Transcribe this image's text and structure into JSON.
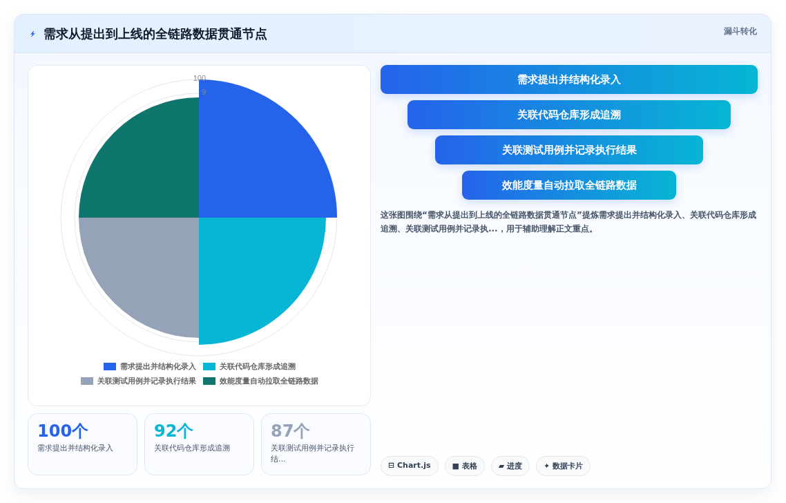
{
  "header": {
    "title": "需求从提出到上线的全链路数据贯通节点",
    "tag": "漏斗转化"
  },
  "chart": {
    "ticks": [
      "100",
      "9"
    ],
    "slices": [
      {
        "label": "需求提出并结构化录入",
        "color": "#2563eb",
        "level": 1
      },
      {
        "label": "关联代码仓库形成追溯",
        "color": "#06b6d4",
        "level": 0.92
      },
      {
        "label": "关联测试用例并记录执行结果",
        "color": "#94a3b8",
        "level": 0.87
      },
      {
        "label": "效能度量自动拉取全链路数据",
        "color": "#0f766e",
        "level": 0.87
      }
    ]
  },
  "stats": [
    {
      "value": "100个",
      "label": "需求提出并结构化录入",
      "color": "#2563eb"
    },
    {
      "value": "92个",
      "label": "关联代码仓库形成追溯",
      "color": "#06b6d4"
    },
    {
      "value": "87个",
      "label": "关联测试用例并记录执行结...",
      "color": "#94a3b8"
    }
  ],
  "funnel": [
    {
      "label": "需求提出并结构化录入"
    },
    {
      "label": "关联代码仓库形成追溯"
    },
    {
      "label": "关联测试用例并记录执行结果"
    },
    {
      "label": "效能度量自动拉取全链路数据"
    }
  ],
  "description": "这张图围绕“需求从提出到上线的全链路数据贯通节点”提炼需求提出并结构化录入、关联代码仓库形成追溯、关联测试用例并记录执...，用于辅助理解正文重点。",
  "chips": [
    {
      "icon": "⊟",
      "label": "Chart.js"
    },
    {
      "icon": "■",
      "label": "表格"
    },
    {
      "icon": "▰",
      "label": "进度"
    },
    {
      "icon": "✦",
      "label": "数据卡片"
    }
  ]
}
